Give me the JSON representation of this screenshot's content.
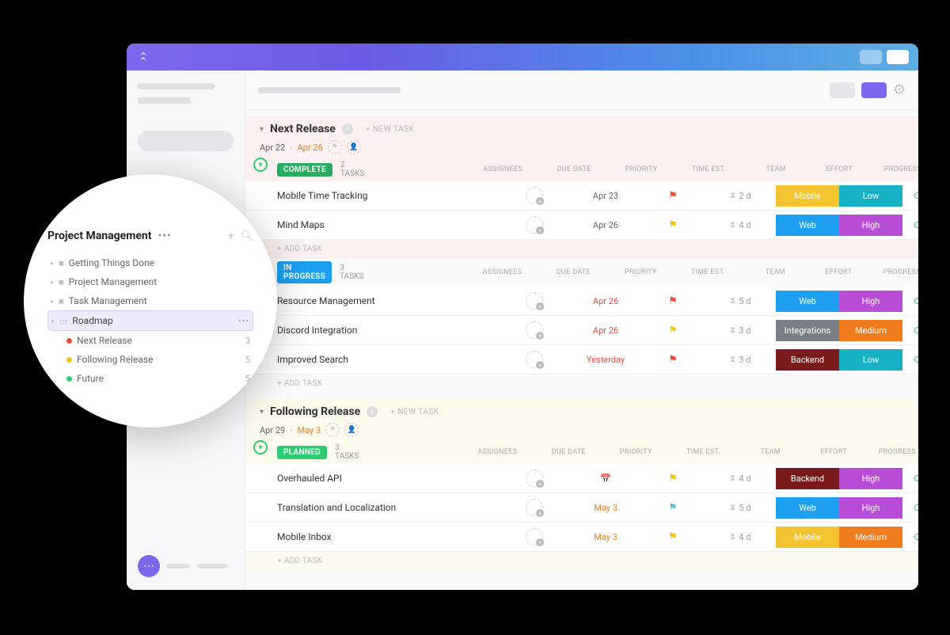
{
  "popup": {
    "title": "Project Management",
    "items": [
      {
        "label": "Getting Things Done"
      },
      {
        "label": "Project Management"
      },
      {
        "label": "Task Management"
      },
      {
        "label": "Roadmap",
        "selected": true
      },
      {
        "label": "Next Release",
        "dot": "d-red",
        "count": "3"
      },
      {
        "label": "Following Release",
        "dot": "d-yellow",
        "count": "5"
      },
      {
        "label": "Future",
        "dot": "d-green",
        "count": "5"
      }
    ]
  },
  "columns": {
    "assignees": "ASSIGNEES",
    "due": "DUE DATE",
    "priority": "PRIORITY",
    "est": "TIME EST.",
    "team": "TEAM",
    "effort": "EFFORT",
    "progress": "PROGRESS"
  },
  "labels": {
    "new_task": "+ NEW TASK",
    "add_task": "+ ADD TASK"
  },
  "groups": [
    {
      "title": "Next Release",
      "date_a": "Apr 22",
      "date_b": "Apr 26",
      "bg": "bg-pink",
      "sections": [
        {
          "badge": "COMPLETE",
          "badge_class": "sb-complete",
          "count": "2 TASKS",
          "tasks": [
            {
              "name": "Mobile Time Tracking",
              "due": "Apr 23",
              "due_class": "",
              "flag": "flag-red",
              "est": "2 d",
              "team": "Mobile",
              "team_class": "t-mobile",
              "effort": "Low",
              "effort_class": "t-low"
            },
            {
              "name": "Mind Maps",
              "due": "Apr 26",
              "due_class": "",
              "flag": "flag-yellow",
              "est": "4 d",
              "team": "Web",
              "team_class": "t-web",
              "effort": "High",
              "effort_class": "t-high"
            }
          ]
        },
        {
          "badge": "IN PROGRESS",
          "badge_class": "sb-progress",
          "count": "3 TASKS",
          "bg": "bg-plain",
          "tasks": [
            {
              "name": "Resource Management",
              "due": "Apr 26",
              "due_class": "overdue",
              "flag": "flag-red",
              "est": "5 d",
              "team": "Web",
              "team_class": "t-web",
              "effort": "High",
              "effort_class": "t-high"
            },
            {
              "name": "Discord Integration",
              "due": "Apr 26",
              "due_class": "overdue",
              "flag": "flag-yellow",
              "est": "3 d",
              "team": "Integrations",
              "team_class": "t-integr",
              "effort": "Medium",
              "effort_class": "t-medium"
            },
            {
              "name": "Improved Search",
              "due": "Yesterday",
              "due_class": "overdue",
              "flag": "flag-red",
              "est": "3 d",
              "team": "Backend",
              "team_class": "t-backend",
              "effort": "Low",
              "effort_class": "t-low"
            }
          ]
        }
      ]
    },
    {
      "title": "Following Release",
      "date_a": "Apr 29",
      "date_b": "May 3",
      "bg": "bg-cream",
      "sections": [
        {
          "badge": "PLANNED",
          "badge_class": "sb-planned",
          "count": "3 TASKS",
          "tasks": [
            {
              "name": "Overhauled API",
              "due": "",
              "due_class": "due-icon",
              "flag": "flag-yellow",
              "est": "4 d",
              "team": "Backend",
              "team_class": "t-backend",
              "effort": "High",
              "effort_class": "t-high"
            },
            {
              "name": "Translation and Localization",
              "due": "May 3",
              "due_class": "future",
              "flag": "flag-teal",
              "est": "5 d",
              "team": "Web",
              "team_class": "t-web",
              "effort": "High",
              "effort_class": "t-high"
            },
            {
              "name": "Mobile Inbox",
              "due": "May 3",
              "due_class": "future",
              "flag": "flag-yellow",
              "est": "4 d",
              "team": "Mobile",
              "team_class": "t-mobile",
              "effort": "Medium",
              "effort_class": "t-medium"
            }
          ]
        }
      ]
    }
  ]
}
